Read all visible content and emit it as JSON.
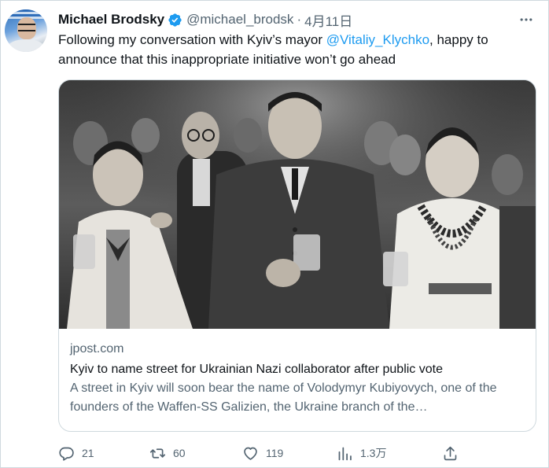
{
  "tweet": {
    "author_name": "Michael Brodsky",
    "handle": "@michael_brodsk",
    "separator": "·",
    "date": "4月11日",
    "text_before": "Following my conversation with Kyiv’s mayor ",
    "mention": "@Vitaliy_Klychko",
    "text_after": ", happy to announce that this inappropriate initiative won’t go ahead"
  },
  "card": {
    "domain": "jpost.com",
    "title": "Kyiv to name street for Ukrainian Nazi collaborator after public vote",
    "description": "A street in Kyiv will soon bear the name of Volodymyr Kubiyovych, one of the founders of the Waffen-SS Galizien, the Ukraine branch of the…"
  },
  "actions": {
    "replies": "21",
    "retweets": "60",
    "likes": "119",
    "views": "1.3万"
  },
  "icons": {
    "verified": "verified-badge-icon",
    "more": "more-dots-icon",
    "reply": "reply-icon",
    "retweet": "retweet-icon",
    "like": "heart-icon",
    "views": "views-bar-chart-icon",
    "share": "share-icon"
  },
  "colors": {
    "accent": "#1d9bf0",
    "text": "#0f1419",
    "muted": "#536471",
    "border": "#cfd9de"
  }
}
